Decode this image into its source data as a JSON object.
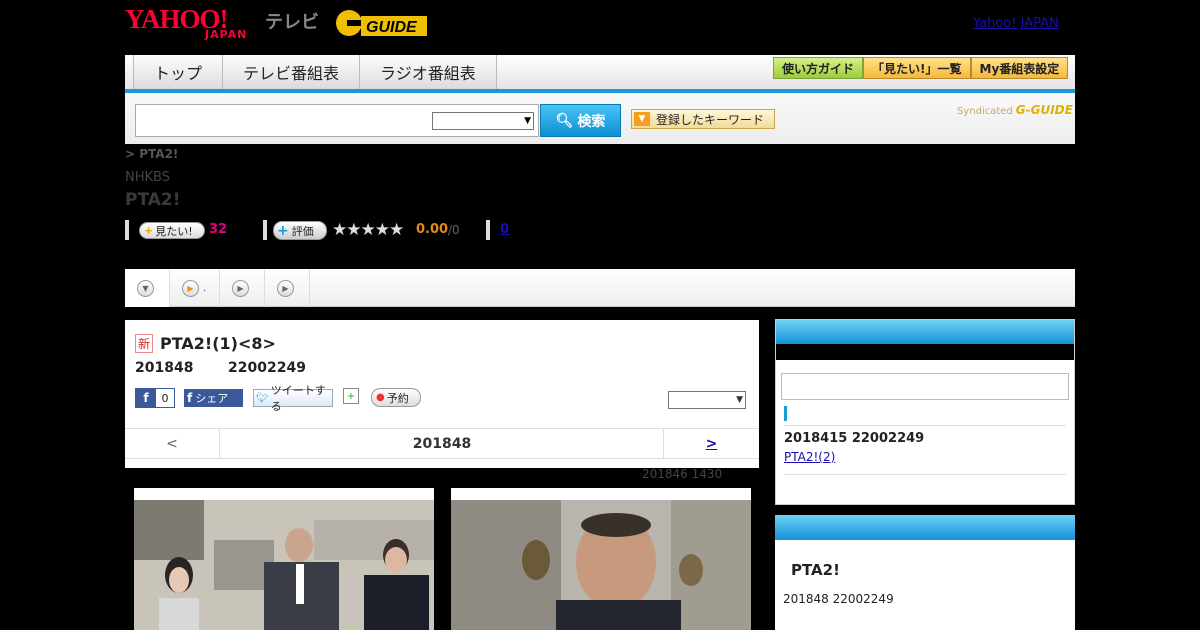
{
  "header": {
    "logo_yahoo": "YAHOO!",
    "logo_japan": "JAPAN",
    "logo_tv": "テレビ",
    "logo_gguide": "G-GUIDE",
    "yahoo_japan_link": "Yahoo! JAPAN"
  },
  "nav": {
    "tabs": [
      {
        "label": "トップ"
      },
      {
        "label": "テレビ番組表"
      },
      {
        "label": "ラジオ番組表"
      }
    ],
    "guide_btn": "使い方ガイド",
    "mitai_list_btn": "「見たい!」一覧",
    "my_schedule_btn": "My番組表設定"
  },
  "search": {
    "input_value": "",
    "button_label": "検索",
    "keyword_btn": "登録したキーワード",
    "syndicated": "Syndicated",
    "syndicated_brand": "G-GUIDE"
  },
  "program": {
    "breadcrumb": "> PTA2!",
    "channel": "NHKBS",
    "title": "PTA2!",
    "mitai_label": "見たい!",
    "mitai_count": "32",
    "hyoka_label": "評価",
    "stars": "★★★★★",
    "score": "0.00",
    "score_den": "/0",
    "review_count": "0"
  },
  "episode": {
    "badge": "新",
    "title": "PTA2!(1)<8>",
    "date": "201848",
    "code": "22002249",
    "fb_like_count": "0",
    "fb_share": "シェア",
    "tweet": "ツイートする",
    "reserve": "予約",
    "pager_prev": "<",
    "pager_current": "201848",
    "pager_next": ">",
    "updated": "201846  1430"
  },
  "sidebar": {
    "next_date": "2018415  22002249",
    "next_link": "PTA2!(2)",
    "box2_title": "PTA2!",
    "box2_info": "201848  22002249"
  },
  "colors": {
    "accent_blue": "#1a9ad8",
    "brand_red": "#ff0033",
    "mitai_pink": "#e4007f",
    "score_orange": "#e08a1e"
  }
}
